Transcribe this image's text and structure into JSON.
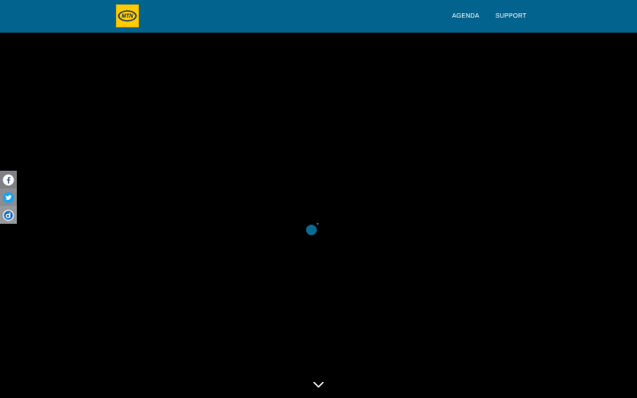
{
  "header": {
    "logo_text": "MTN",
    "nav": [
      {
        "label": "AGENDA"
      },
      {
        "label": "SUPPORT"
      }
    ]
  },
  "social": {
    "items": [
      {
        "icon": "facebook-icon",
        "color": "#3b5998"
      },
      {
        "icon": "twitter-icon",
        "color": "#1da1f2"
      },
      {
        "icon": "digg-icon",
        "color": "#1e6ec0"
      }
    ]
  },
  "colors": {
    "header_bg": "#02648e",
    "logo_bg": "#ffcb05",
    "page_bg": "#000000",
    "loader": "#0a6a93"
  }
}
